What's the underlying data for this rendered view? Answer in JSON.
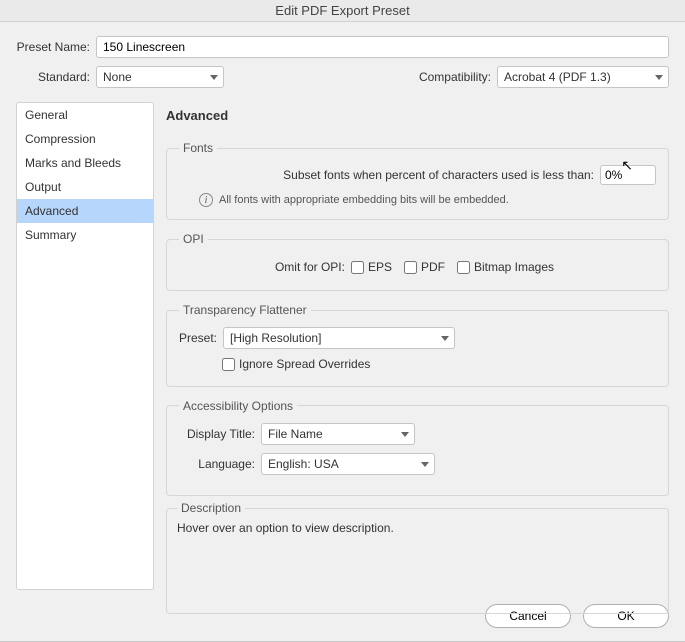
{
  "window": {
    "title": "Edit PDF Export Preset"
  },
  "top": {
    "presetNameLabel": "Preset Name:",
    "presetNameValue": "150 Linescreen",
    "standardLabel": "Standard:",
    "standardValue": "None",
    "compatLabel": "Compatibility:",
    "compatValue": "Acrobat 4 (PDF 1.3)"
  },
  "sidebar": {
    "items": [
      {
        "label": "General"
      },
      {
        "label": "Compression"
      },
      {
        "label": "Marks and Bleeds"
      },
      {
        "label": "Output"
      },
      {
        "label": "Advanced"
      },
      {
        "label": "Summary"
      }
    ],
    "selectedIndex": 4
  },
  "panel": {
    "heading": "Advanced",
    "fonts": {
      "legend": "Fonts",
      "subsetLabel": "Subset fonts when percent of characters used is less than:",
      "subsetValue": "0%",
      "infoText": "All fonts with appropriate embedding bits will be embedded."
    },
    "opi": {
      "legend": "OPI",
      "omitLabel": "Omit for OPI:",
      "epsLabel": "EPS",
      "pdfLabel": "PDF",
      "bitmapLabel": "Bitmap Images"
    },
    "transparency": {
      "legend": "Transparency Flattener",
      "presetLabel": "Preset:",
      "presetValue": "[High Resolution]",
      "ignoreLabel": "Ignore Spread Overrides"
    },
    "accessibility": {
      "legend": "Accessibility Options",
      "displayTitleLabel": "Display Title:",
      "displayTitleValue": "File Name",
      "languageLabel": "Language:",
      "languageValue": "English: USA"
    },
    "description": {
      "legend": "Description",
      "text": "Hover over an option to view description."
    }
  },
  "footer": {
    "cancel": "Cancel",
    "ok": "OK"
  }
}
